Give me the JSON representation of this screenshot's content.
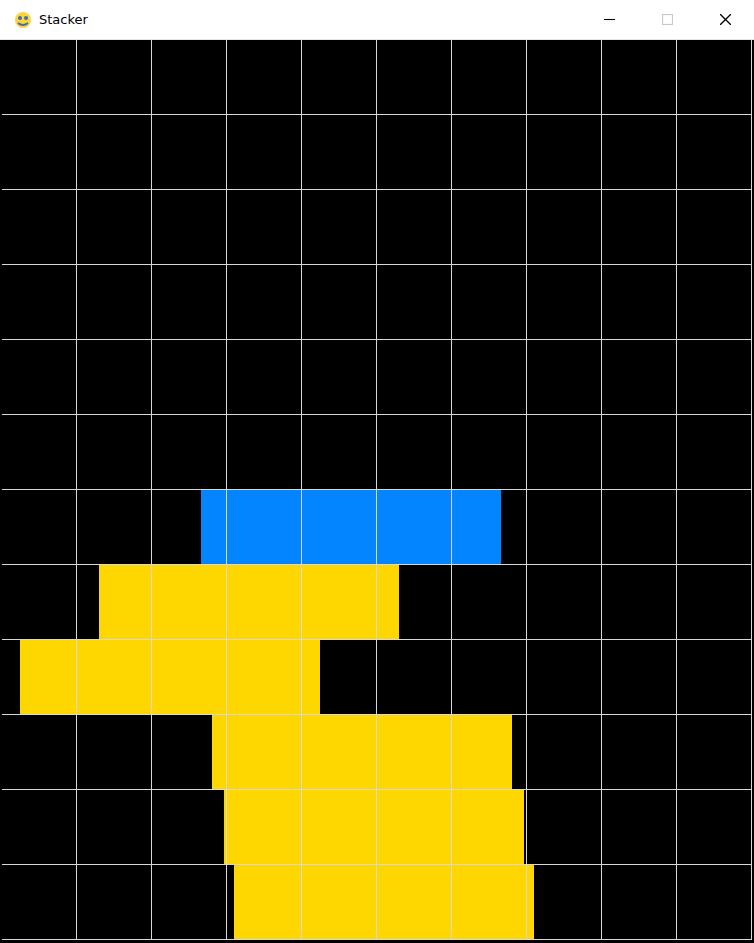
{
  "window": {
    "title": "Stacker",
    "controls": [
      {
        "kind": "minimize",
        "disabled": false
      },
      {
        "kind": "maximize",
        "disabled": true
      },
      {
        "kind": "close",
        "disabled": false
      }
    ]
  },
  "board": {
    "columns": 10,
    "rows": 12,
    "stack": [
      {
        "offset": 3.09,
        "span": 4,
        "color": "#ffd700"
      },
      {
        "offset": 2.96,
        "span": 4,
        "color": "#ffd700"
      },
      {
        "offset": 2.8,
        "span": 4,
        "color": "#ffd700"
      },
      {
        "offset": 0.24,
        "span": 4,
        "color": "#ffd700"
      },
      {
        "offset": 1.29,
        "span": 4,
        "color": "#ffd700"
      },
      {
        "offset": 2.65,
        "span": 4,
        "color": "#0385ff"
      }
    ]
  }
}
